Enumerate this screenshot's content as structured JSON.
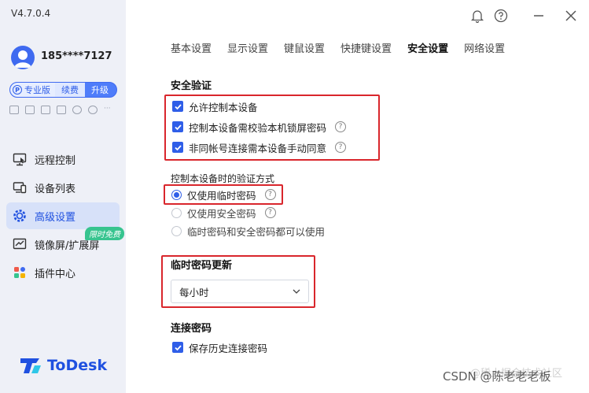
{
  "app": {
    "version": "V4.7.0.4",
    "user_phone": "185****7127",
    "plan": {
      "pro_label": "专业版",
      "pro_icon": "P",
      "renew_label": "续费",
      "upgrade_label": "升级"
    },
    "logo_text": "ToDesk"
  },
  "sidebar": {
    "items": [
      {
        "label": "远程控制",
        "icon": "monitor-cursor-icon"
      },
      {
        "label": "设备列表",
        "icon": "devices-icon"
      },
      {
        "label": "高级设置",
        "icon": "gear-icon",
        "active": true
      },
      {
        "label": "镜像屏/扩展屏",
        "icon": "mirror-screen-icon"
      },
      {
        "label": "插件中心",
        "icon": "plugins-icon"
      }
    ],
    "free_badge": "限时免费"
  },
  "tabs": [
    "基本设置",
    "显示设置",
    "键鼠设置",
    "快捷键设置",
    "安全设置",
    "网络设置"
  ],
  "active_tab": "安全设置",
  "security": {
    "title": "安全验证",
    "options": [
      {
        "label": "允许控制本设备",
        "checked": true,
        "help": false
      },
      {
        "label": "控制本设备需校验本机锁屏密码",
        "checked": true,
        "help": true
      },
      {
        "label": "非同帐号连接需本设备手动同意",
        "checked": true,
        "help": true
      }
    ]
  },
  "verify": {
    "title": "控制本设备时的验证方式",
    "options": [
      {
        "label": "仅使用临时密码",
        "selected": true,
        "help": true
      },
      {
        "label": "仅使用安全密码",
        "selected": false,
        "help": true
      },
      {
        "label": "临时密码和安全密码都可以使用",
        "selected": false,
        "help": false
      }
    ]
  },
  "temp_password": {
    "title": "临时密码更新",
    "selected": "每小时"
  },
  "connect_password": {
    "title": "连接密码",
    "save_history_label": "保存历史连接密码",
    "save_history_checked": true
  },
  "watermark": "CSDN @陈老老老板",
  "watermark_faint": "@稀土掘金技术社区",
  "colors": {
    "accent": "#2f5ee8",
    "highlight_box": "#d9262c",
    "sidebar_bg": "#eef0f7"
  }
}
